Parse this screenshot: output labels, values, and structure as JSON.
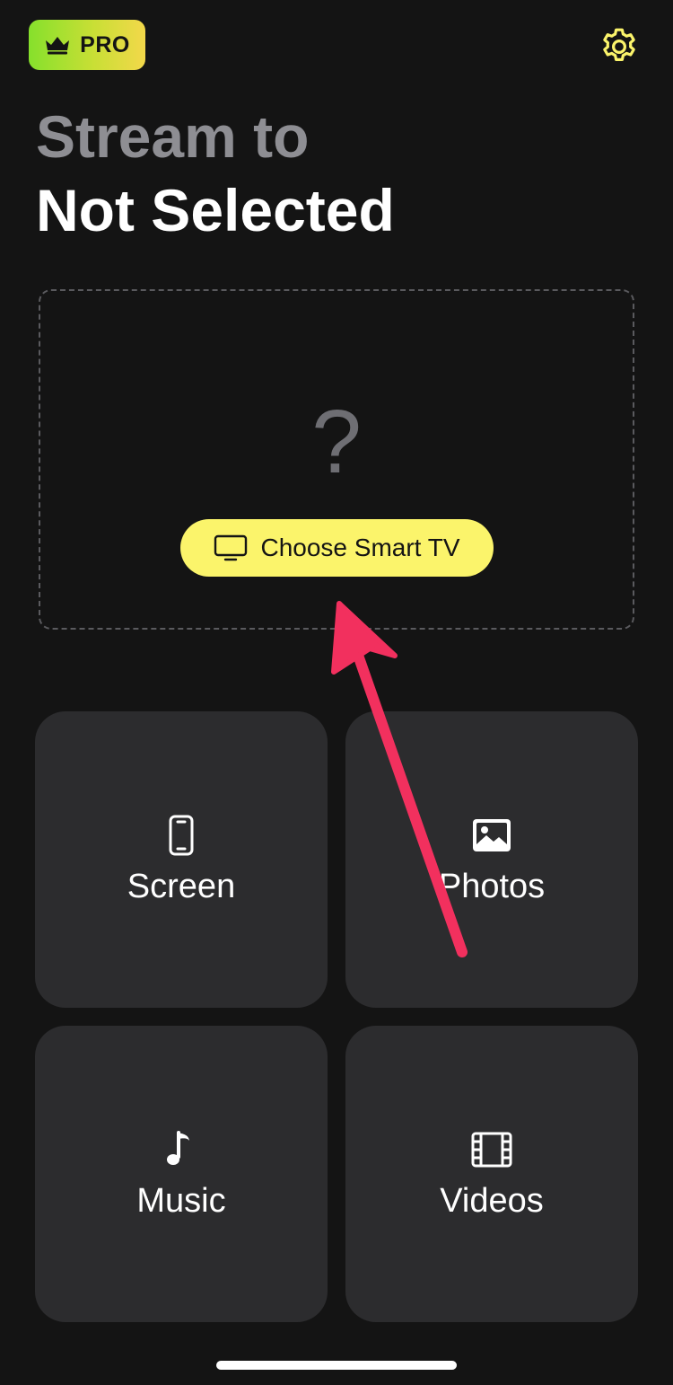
{
  "header": {
    "pro_label": "PRO",
    "crown_icon": "crown-icon",
    "settings_icon": "gear-icon"
  },
  "title": {
    "line1": "Stream to",
    "line2": "Not Selected"
  },
  "device_box": {
    "placeholder_symbol": "?",
    "choose_button_label": "Choose Smart TV",
    "tv_icon": "tv-icon"
  },
  "tiles": [
    {
      "label": "Screen",
      "icon": "phone-icon"
    },
    {
      "label": "Photos",
      "icon": "photo-icon"
    },
    {
      "label": "Music",
      "icon": "music-note-icon"
    },
    {
      "label": "Videos",
      "icon": "film-icon"
    }
  ],
  "colors": {
    "background": "#141414",
    "tile": "#2c2c2e",
    "accent_yellow": "#fbf46b",
    "pro_gradient_start": "#86e02c",
    "pro_gradient_end": "#f3d84a",
    "annotation_arrow": "#f2305e",
    "muted_text": "#8e8e93"
  }
}
